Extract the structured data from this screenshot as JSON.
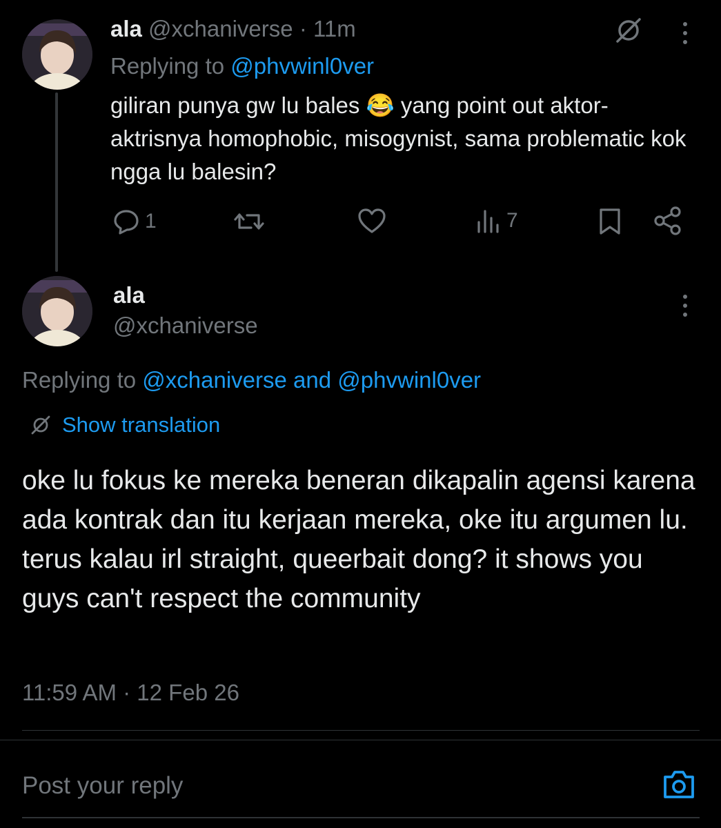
{
  "tweet1": {
    "display_name": "ala",
    "handle": "@xchaniverse",
    "separator": "·",
    "time_ago": "11m",
    "replying_prefix": "Replying to",
    "replying_to": "@phvwinl0ver",
    "body_before_emoji": "giliran punya gw lu bales",
    "emoji": "😂",
    "body_after_emoji": "yang point out aktor-aktrisnya homophobic, misogynist, sama problematic kok ngga lu balesin?",
    "actions": {
      "reply_count": "1",
      "views_count": "7"
    },
    "icons": [
      "translate-off-icon",
      "more-icon",
      "reply-icon",
      "retweet-icon",
      "like-icon",
      "views-icon",
      "bookmark-icon",
      "share-icon"
    ]
  },
  "tweet2": {
    "display_name": "ala",
    "handle": "@xchaniverse",
    "replying_prefix": "Replying to",
    "replying_to_1": "@xchaniverse",
    "replying_and": "and",
    "replying_to_2": "@phvwinl0ver",
    "translate_label": "Show translation",
    "body": "oke lu fokus ke mereka beneran dikapalin agensi karena ada kontrak dan itu kerjaan mereka, oke itu argumen lu. terus kalau irl straight, queerbait dong? it shows you guys can't respect the community",
    "timestamp": "11:59 AM · 12 Feb 26",
    "icons": [
      "more-icon",
      "translate-icon"
    ]
  },
  "composer": {
    "placeholder": "Post your reply",
    "icons": [
      "camera-icon"
    ]
  },
  "colors": {
    "background": "#000000",
    "text": "#e7e9ea",
    "muted": "#71767b",
    "accent": "#1d9bf0",
    "border": "#2f3336"
  }
}
